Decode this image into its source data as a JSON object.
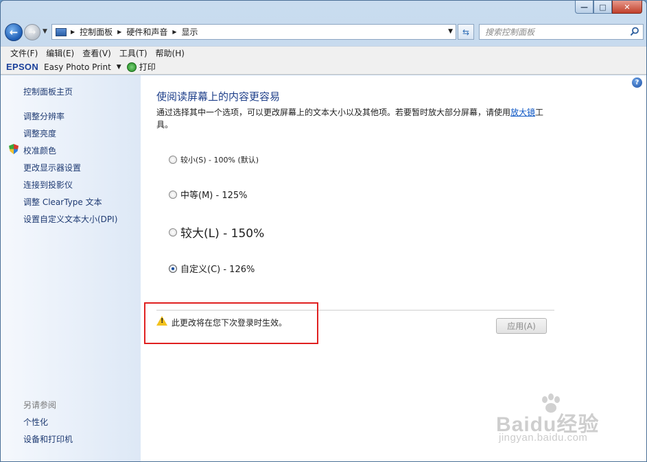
{
  "window": {
    "minimize_glyph": "—",
    "maximize_glyph": "□",
    "close_glyph": "✕"
  },
  "nav": {
    "back_glyph": "←",
    "forward_glyph": "→",
    "breadcrumb": [
      "控制面板",
      "硬件和声音",
      "显示"
    ],
    "search_placeholder": "搜索控制面板"
  },
  "menu": [
    "文件(F)",
    "编辑(E)",
    "查看(V)",
    "工具(T)",
    "帮助(H)"
  ],
  "epson": {
    "brand": "EPSON",
    "app": "Easy Photo Print",
    "print": "打印"
  },
  "sidebar": {
    "home": "控制面板主页",
    "links": [
      "调整分辨率",
      "调整亮度",
      "校准颜色",
      "更改显示器设置",
      "连接到投影仪",
      "调整 ClearType 文本",
      "设置自定义文本大小(DPI)"
    ],
    "see_also_title": "另请参阅",
    "see_also": [
      "个性化",
      "设备和打印机"
    ]
  },
  "main": {
    "heading": "使阅读屏幕上的内容更容易",
    "desc_before": "通过选择其中一个选项，可以更改屏幕上的文本大小以及其他项。若要暂时放大部分屏幕，请使用",
    "desc_link": "放大镜",
    "desc_after": "工具。",
    "options": [
      {
        "label": "较小(S) - 100% (默认)",
        "checked": false
      },
      {
        "label": "中等(M) - 125%",
        "checked": false
      },
      {
        "label": "较大(L) - 150%",
        "checked": false
      },
      {
        "label": "自定义(C) - 126%",
        "checked": true
      }
    ],
    "warning": "此更改将在您下次登录时生效。",
    "apply": "应用(A)"
  },
  "watermark": {
    "text": "Baidu经验",
    "sub": "jingyan.baidu.com"
  }
}
